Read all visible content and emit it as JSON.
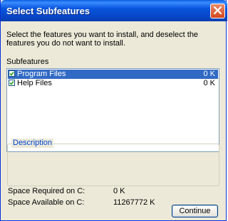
{
  "window": {
    "title": "Select Subfeatures"
  },
  "prompt": "Select the features you want to install, and deselect the features you do not want to install.",
  "subfeatures": {
    "label": "Subfeatures",
    "items": [
      {
        "label": "Program Files",
        "size": "0 K",
        "checked": true,
        "selected": true
      },
      {
        "label": "Help Files",
        "size": "0 K",
        "checked": true,
        "selected": false
      }
    ]
  },
  "description": {
    "title": "Description"
  },
  "space": {
    "required_label": "Space Required on C:",
    "required_value": "0 K",
    "available_label": "Space Available on C:",
    "available_value": "11267772 K"
  },
  "buttons": {
    "continue": "Continue"
  },
  "icons": {
    "close": "close-icon",
    "checkbox": "checkmark-icon"
  },
  "colors": {
    "titlebar": "#0855dd",
    "selection": "#316ac5",
    "group_title": "#0046d5"
  }
}
